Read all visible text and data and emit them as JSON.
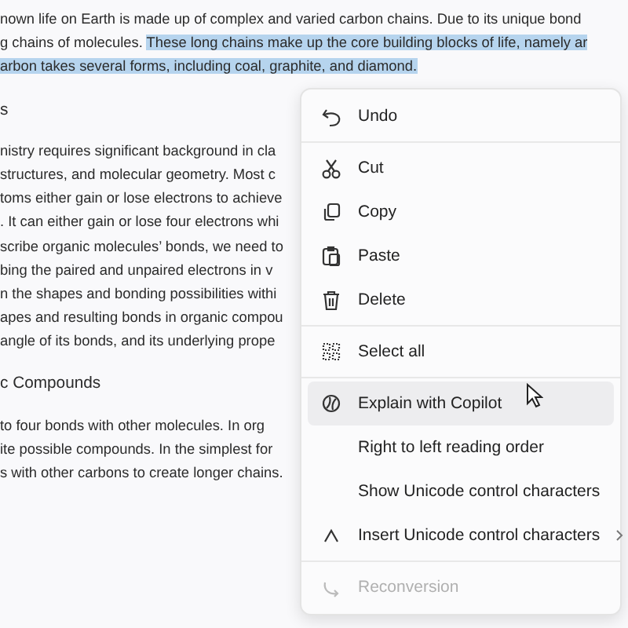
{
  "document": [
    {
      "kind": "para",
      "lines": [
        [
          {
            "text": "nown life on Earth is made up of complex and varied carbon chains. Due to its unique bond",
            "selected": false
          }
        ],
        [
          {
            "text": "g chains of molecules. ",
            "selected": false
          },
          {
            "text": "These long chains make up the core building blocks of life, namely ar",
            "selected": true
          }
        ],
        [
          {
            "text": "arbon takes several forms, including coal, graphite, and diamond.",
            "selected": true
          }
        ]
      ]
    },
    {
      "kind": "heading",
      "lines": [
        [
          {
            "text": "s",
            "selected": false
          }
        ]
      ]
    },
    {
      "kind": "para",
      "lines": [
        [
          {
            "text": "nistry requires significant background in cla",
            "selected": false
          }
        ],
        [
          {
            "text": " structures, and molecular geometry. Most c",
            "selected": false
          }
        ],
        [
          {
            "text": "toms either gain or lose electrons to achieve",
            "selected": false
          }
        ],
        [
          {
            "text": ". It can either gain or lose four electrons whi",
            "selected": false
          }
        ],
        [
          {
            "text": "scribe organic molecules’ bonds, we need to",
            "selected": false
          }
        ],
        [
          {
            "text": "bing the paired and unpaired electrons in v",
            "selected": false
          }
        ],
        [
          {
            "text": "n the shapes and bonding possibilities withi",
            "selected": false
          }
        ],
        [
          {
            "text": "apes and resulting bonds in organic compou",
            "selected": false
          }
        ],
        [
          {
            "text": "angle of its bonds, and its underlying prope",
            "selected": false
          }
        ]
      ]
    },
    {
      "kind": "heading",
      "lines": [
        [
          {
            "text": "c Compounds",
            "selected": false
          }
        ]
      ]
    },
    {
      "kind": "para",
      "lines": [
        [
          {
            "text": "to four bonds with other molecules. In org",
            "selected": false
          }
        ],
        [
          {
            "text": "ite possible compounds. In the simplest for",
            "selected": false
          }
        ],
        [
          {
            "text": "s with other carbons to create longer chains.",
            "selected": false
          }
        ]
      ]
    }
  ],
  "context_menu": [
    {
      "kind": "item",
      "label": "Undo",
      "hovered": false,
      "disabled": false
    },
    {
      "kind": "separator"
    },
    {
      "kind": "item",
      "label": "Cut",
      "hovered": false,
      "disabled": false
    },
    {
      "kind": "item",
      "label": "Copy",
      "hovered": false,
      "disabled": false
    },
    {
      "kind": "item",
      "label": "Paste",
      "hovered": false,
      "disabled": false
    },
    {
      "kind": "item",
      "label": "Delete",
      "hovered": false,
      "disabled": false
    },
    {
      "kind": "separator"
    },
    {
      "kind": "item",
      "label": "Select all",
      "hovered": false,
      "disabled": false
    },
    {
      "kind": "separator"
    },
    {
      "kind": "item",
      "label": "Explain with Copilot",
      "hovered": true,
      "disabled": false
    },
    {
      "kind": "item",
      "label": "Right to left reading order",
      "hovered": false,
      "disabled": false
    },
    {
      "kind": "item",
      "label": "Show Unicode control characters",
      "hovered": false,
      "disabled": false
    },
    {
      "kind": "submenu",
      "label": "Insert Unicode control characters",
      "hovered": false,
      "disabled": false
    },
    {
      "kind": "separator"
    },
    {
      "kind": "item",
      "label": "Reconversion",
      "hovered": false,
      "disabled": true
    }
  ]
}
